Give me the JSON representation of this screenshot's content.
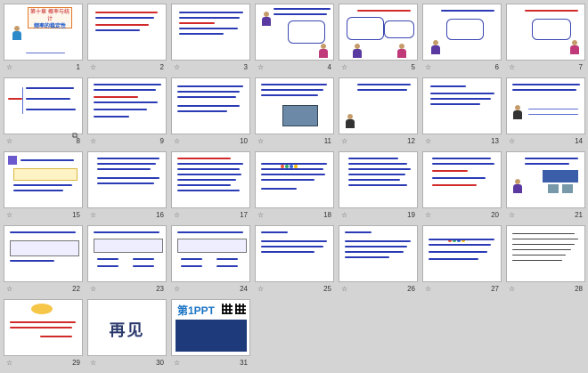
{
  "slides": [
    {
      "n": "1",
      "title": "第十章 概率与统计",
      "subtitle": "频率的稳定性",
      "tag": "第十章 概率与统计"
    },
    {
      "n": "2"
    },
    {
      "n": "3"
    },
    {
      "n": "4"
    },
    {
      "n": "5"
    },
    {
      "n": "6"
    },
    {
      "n": "7"
    },
    {
      "n": "8"
    },
    {
      "n": "9"
    },
    {
      "n": "10"
    },
    {
      "n": "11"
    },
    {
      "n": "12"
    },
    {
      "n": "13"
    },
    {
      "n": "14"
    },
    {
      "n": "15"
    },
    {
      "n": "16"
    },
    {
      "n": "17"
    },
    {
      "n": "18"
    },
    {
      "n": "19"
    },
    {
      "n": "20"
    },
    {
      "n": "21"
    },
    {
      "n": "22"
    },
    {
      "n": "23"
    },
    {
      "n": "24"
    },
    {
      "n": "25"
    },
    {
      "n": "26"
    },
    {
      "n": "27"
    },
    {
      "n": "28"
    },
    {
      "n": "29"
    },
    {
      "n": "30",
      "text": "再见"
    },
    {
      "n": "31",
      "brand": "第1PPT"
    }
  ],
  "star_glyph": "☆",
  "colors": {
    "background": "#d4d4d4",
    "accent_blue": "#2a3bb5",
    "accent_red": "#d22a2a"
  }
}
